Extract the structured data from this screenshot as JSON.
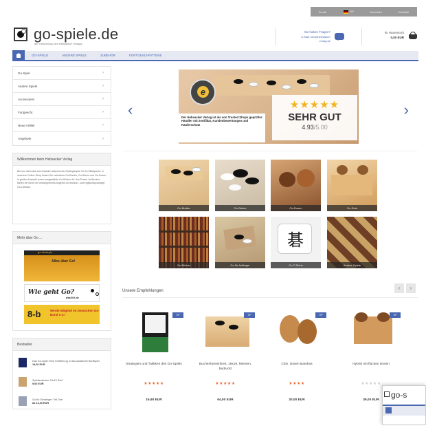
{
  "topbar": {
    "items": [
      "Kunde",
      "DE",
      "Anmelden",
      "Merkliste"
    ]
  },
  "header": {
    "logo_text": "go-spiele.de",
    "logo_subtitle": "der Onlineshop des Hebsacker Verlags",
    "hotline_l1": "Sie haben Fragen?",
    "hotline_l2": "E-Mail: info@hebsacker",
    "hotline_l3": "verlag.de",
    "cart_label": "Ihr Warenkorb",
    "cart_total": "0,00 EUR"
  },
  "nav": {
    "items": [
      "GO-SPIELE",
      "ANDERE SPIELE",
      "ZUBEHÖR",
      "FORTGESCHRITTENE"
    ]
  },
  "sidebar": {
    "categories": [
      "Go-Spiel",
      "Andere Spiele",
      "Accessoires",
      "Fortgeschr.",
      "Neue Artikel",
      "Angebote"
    ],
    "welcome_title": "Willkommen beim Hebsacker Verlag",
    "welcome_text": "Bei uns steht das aus Ostasien stammende Strategiespiel Go im Mittelpunkt. In unserem Online-Shop finden Sie zahlreiche Go-Bretter, Go-Steine und Go-Dosen in großer Auswahl sowie ausgewählte Go-Bücher für Ihre Praxis. Außerdem bieten wir Ihnen ein umfangreiches Angebot an deutsch- und englischsprachiger Go-Literatur.",
    "mehr_title": "Mehr über Go ...",
    "banner1_text": "Alles über Go!",
    "banner1_strip": "go-strategie",
    "banner2_text": "Wie geht Go?",
    "banner2_sub": "dasGO.de",
    "banner3_letters": "8-b",
    "banner3_text": "Werde Mitglied im Deutschen Go-Bund e.V.!",
    "best_title": "Bestseller",
    "best_items": [
      {
        "name": "Das Go-Spiel: Eine Einführung in das asiatische Brettspiel",
        "price": "19,00 EUR"
      },
      {
        "name": "Spielbrettchen 13x13 Schl.",
        "price": "9,00 EUR"
      },
      {
        "name": "Go für Einsteiger: Teil Drei",
        "price": "ab 14,00 EUR"
      }
    ]
  },
  "slider": {
    "caption": "Der Hebsacker Verlag ist als von Trusted Shops geprüfter Händler mit Zertifikat, Kundenbewertungen und Käuferschutz",
    "stars": "★★★★★",
    "rating_label": "SEHR GUT",
    "score": "4.93",
    "score_max": "/5.00",
    "seal_letter": "e"
  },
  "tiles": [
    {
      "label": "Go-Bretter"
    },
    {
      "label": "Go-Steine"
    },
    {
      "label": "Go-Dosen"
    },
    {
      "label": "Go-Sets"
    },
    {
      "label": "Go-Bücher"
    },
    {
      "label": "Go für Anfänger"
    },
    {
      "label": "Go-T-Shirts"
    },
    {
      "label": "Andere Spiele"
    }
  ],
  "recommendations": {
    "title": "Unsere Empfehlungen",
    "products": [
      {
        "name": "Strategien und Taktiken des Go-Spiels",
        "rating": "★★★★★",
        "price": "16,90 EUR",
        "badge": "TIP"
      },
      {
        "name": "Buchenfurnierbrett, 19x19, Mensen, bedruckt",
        "rating": "★★★★★",
        "price": "64,00 EUR",
        "badge": "TIP"
      },
      {
        "name": "Chin. Dosen Bambus",
        "rating": "★★★★",
        "price": "30,00 EUR",
        "badge": "TIP"
      },
      {
        "name": "Hybrid mit flachen Dosen",
        "rating": "★★★★★",
        "price": "39,00 EUR",
        "badge": "TIP"
      }
    ]
  },
  "overlay": {
    "logo_text": "go-s"
  },
  "colors": {
    "accent": "#4a67b2",
    "star": "#f3b419",
    "rating": "#e8672c"
  }
}
